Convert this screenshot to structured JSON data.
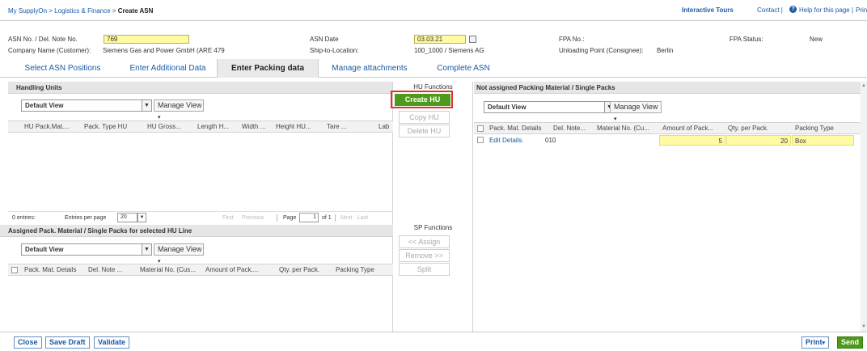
{
  "breadcrumb": {
    "part1": "My SupplyOn",
    "sep1": ">",
    "part2": "Logistics & Finance",
    "sep2": ">",
    "current": "Create ASN"
  },
  "topright": {
    "tours": "Interactive Tours",
    "contact": "Contact |",
    "help": "Help for this page",
    "sep": "|",
    "print": "Print"
  },
  "header": {
    "asn_no_label": "ASN No. / Del. Note No.",
    "asn_no_value": "769",
    "asn_date_label": "ASN Date",
    "asn_date_value": "03.03.21",
    "fpa_no_label": "FPA No.:",
    "fpa_status_label": "FPA Status:",
    "fpa_status_value": "New",
    "company_label": "Company Name (Customer):",
    "company_value": "Siemens Gas and Power GmbH (ARE 479",
    "ship_label": "Ship-to-Location:",
    "ship_value": "100_1000 / Siemens AG",
    "unloading_label": "Unloading Point (Consignee):",
    "unloading_value": "Berlin"
  },
  "tabs": [
    "Select ASN Positions",
    "Enter Additional Data",
    "Enter Packing data",
    "Manage attachments",
    "Complete ASN"
  ],
  "hu": {
    "title": "Handling Units",
    "view": "Default View",
    "manage": "Manage View",
    "columns": [
      "HU Pack.Mat....",
      "Pack. Type HU",
      "HU Gross...",
      "Length H...",
      "Width ...",
      "Height HU...",
      "Tare ...",
      "Lab"
    ],
    "entries": "0 entries:",
    "per_page_label": "Entries per page",
    "per_page": "20",
    "first": "First",
    "previous": "Previous",
    "page_label": "Page",
    "page": "1",
    "of": "of 1",
    "next": "Next",
    "last": "Last"
  },
  "assigned": {
    "title": "Assigned Pack. Material / Single Packs for selected HU Line",
    "view": "Default View",
    "manage": "Manage View",
    "columns": [
      "Pack. Mat. Details",
      "Del. Note ...",
      "Material No. (Cus...",
      "Amount of Pack....",
      "Qty. per Pack.",
      "Packing Type"
    ]
  },
  "hu_functions": {
    "title": "HU Functions",
    "create": "Create HU",
    "copy": "Copy HU",
    "delete": "Delete HU"
  },
  "sp_functions": {
    "title": "SP Functions",
    "assign": "<< Assign",
    "remove": "Remove >>",
    "split": "Split"
  },
  "unassigned": {
    "title": "Not assigned Packing Material / Single Packs",
    "view": "Default View",
    "manage": "Manage View",
    "columns": [
      "Pack. Mat. Details",
      "Del. Note...",
      "Material No. (Cu...",
      "Amount of Pack...",
      "Qty. per Pack.",
      "Packing Type"
    ],
    "row": {
      "details": "Edit Details.",
      "del_note": "010",
      "amount": "5",
      "qty": "20",
      "type": "Box"
    }
  },
  "footer": {
    "close": "Close",
    "save": "Save Draft",
    "validate": "Validate",
    "print": "Print",
    "send": "Send"
  }
}
